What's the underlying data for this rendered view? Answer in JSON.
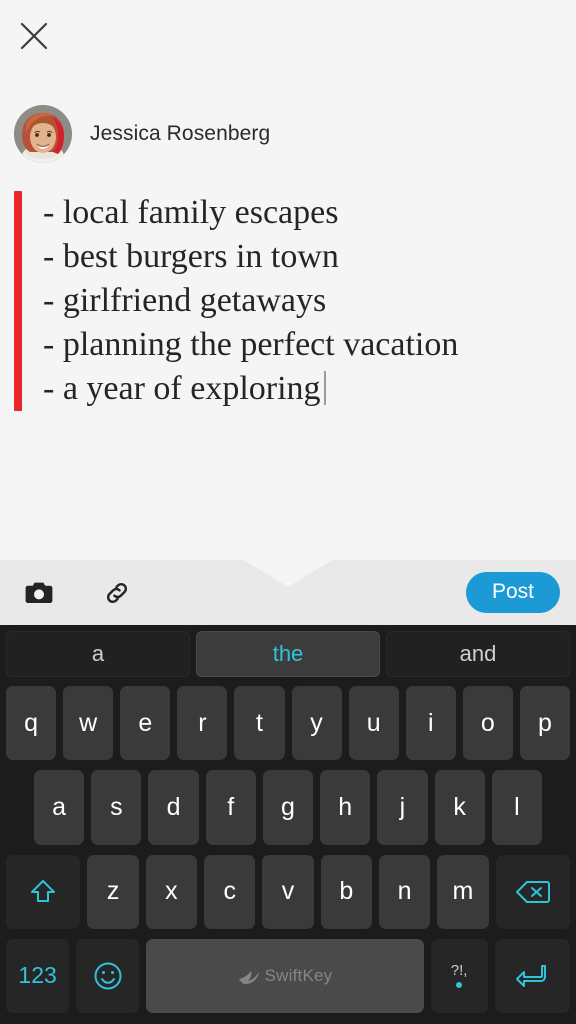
{
  "compose": {
    "close_icon": "close-x-icon",
    "author_name": "Jessica Rosenberg",
    "avatar_alt": "user-avatar-photo",
    "quote_accent_color": "#e8262b",
    "post_text": "- local family escapes\n- best burgers in town\n- girlfriend getaways\n- planning the perfect vacation\n- a year of exploring"
  },
  "toolbar": {
    "camera_icon": "camera-icon",
    "link_icon": "link-icon",
    "post_label": "Post",
    "post_color": "#1b9ad6"
  },
  "keyboard": {
    "app": "SwiftKey",
    "accent_color": "#2ec4d9",
    "suggestions": [
      {
        "label": "a",
        "active": false
      },
      {
        "label": "the",
        "active": true
      },
      {
        "label": "and",
        "active": false
      }
    ],
    "row1": [
      "q",
      "w",
      "e",
      "r",
      "t",
      "y",
      "u",
      "i",
      "o",
      "p"
    ],
    "row2": [
      "a",
      "s",
      "d",
      "f",
      "g",
      "h",
      "j",
      "k",
      "l"
    ],
    "row3": [
      "z",
      "x",
      "c",
      "v",
      "b",
      "n",
      "m"
    ],
    "shift_icon": "shift-up-arrow-icon",
    "backspace_icon": "backspace-delete-icon",
    "numbers_label": "123",
    "emoji_icon": "emoji-smiley-icon",
    "space_label": "SwiftKey",
    "punctuation_label": "?!,",
    "punctuation_secondary": ".",
    "enter_icon": "enter-return-icon"
  }
}
